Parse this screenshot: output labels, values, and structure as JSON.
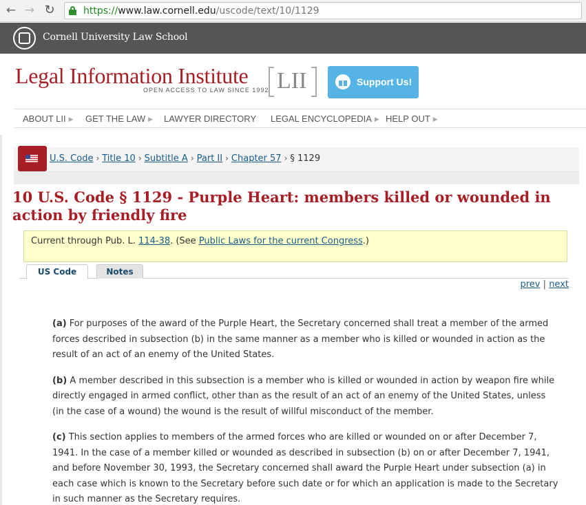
{
  "browser": {
    "url_scheme": "https://",
    "url_host": "www.law.cornell.edu",
    "url_path": "/uscode/text/10/1129"
  },
  "banner": {
    "name": "Cornell University Law School"
  },
  "header": {
    "title": "Legal Information Institute",
    "tagline": "OPEN ACCESS TO LAW SINCE 1992",
    "logo_text": "LII",
    "support_label": "Support Us!"
  },
  "nav": {
    "items": [
      {
        "label": "ABOUT LII"
      },
      {
        "label": "GET THE LAW"
      },
      {
        "label": "LAWYER DIRECTORY"
      },
      {
        "label": "LEGAL ENCYCLOPEDIA"
      },
      {
        "label": "HELP OUT"
      }
    ]
  },
  "breadcrumb": {
    "items": [
      {
        "label": "U.S. Code"
      },
      {
        "label": "Title 10"
      },
      {
        "label": "Subtitle A"
      },
      {
        "label": "Part II"
      },
      {
        "label": "Chapter 57"
      }
    ],
    "current": "§ 1129"
  },
  "page": {
    "title": "10 U.S. Code § 1129 - Purple Heart: members killed or wounded in action by friendly fire"
  },
  "currency": {
    "prefix": "Current through Pub. L. ",
    "pub_law": "114-38",
    "middle": ". (See ",
    "link": "Public Laws for the current Congress",
    "suffix": ".)"
  },
  "tabs": {
    "active": "US Code",
    "inactive": "Notes"
  },
  "pager": {
    "prev": "prev",
    "separator": "|",
    "next": "next"
  },
  "content": {
    "paragraphs": [
      {
        "label": "(a)",
        "text": " For purposes of the award of the Purple Heart, the Secretary concerned shall treat a member of the armed forces described in subsection (b) in the same manner as a member who is killed or wounded in action as the result of an act of an enemy of the United States."
      },
      {
        "label": "(b)",
        "text": " A member described in this subsection is a member who is killed or wounded in action by weapon fire while directly engaged in armed conflict, other than as the result of an act of an enemy of the United States, unless (in the case of a wound) the wound is the result of willful misconduct of the member."
      },
      {
        "label": "(c)",
        "text": " This section applies to members of the armed forces who are killed or wounded on or after December 7, 1941. In the case of a member killed or wounded as described in subsection (b) on or after December 7, 1941, and before November 30, 1993, the Secretary concerned shall award the Purple Heart under subsection (a) in each case which is known to the Secretary before such date or for which an application is made to the Secretary in such manner as the Secretary requires."
      }
    ]
  },
  "colors": {
    "brand_red": "#a81e25",
    "link_blue": "#1a5d8a",
    "support_blue": "#55b3e6",
    "notice_yellow": "#ffffcc"
  }
}
